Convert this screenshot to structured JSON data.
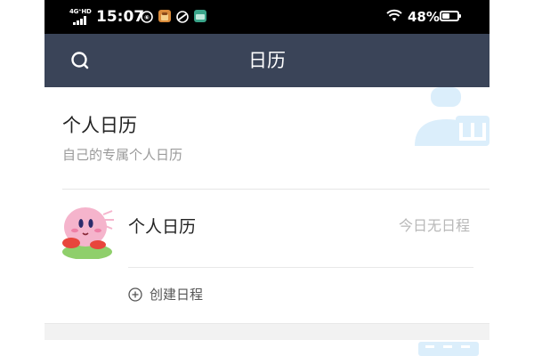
{
  "status_bar": {
    "network": "4G⁺HD",
    "time": "15:07",
    "battery_text": "48%",
    "battery_level": 0.48,
    "icons": [
      "signal-icon",
      "notification-app-icon",
      "notification-app-icon",
      "notification-app-icon",
      "notification-app-icon",
      "wifi-icon",
      "battery-icon"
    ]
  },
  "nav": {
    "title": "日历",
    "search_icon": "search-icon"
  },
  "header": {
    "title": "个人日历",
    "subtitle": "自己的专属个人日历"
  },
  "calendar": {
    "name": "个人日历",
    "status": "今日无日程",
    "create_label": "创建日程",
    "avatar_icon": "kirby-avatar-icon"
  },
  "colors": {
    "status_bar_bg": "#000000",
    "nav_bg": "#3a4458",
    "page_bg": "#ffffff",
    "section_gap_bg": "#f2f2f2",
    "accent_light_blue": "#d8ecfa",
    "muted_text": "#9a9a9a"
  }
}
